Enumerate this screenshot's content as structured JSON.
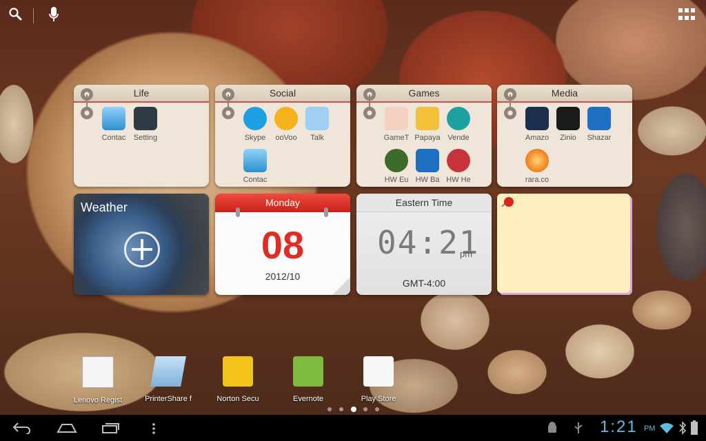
{
  "folders": [
    {
      "title": "Life",
      "apps": [
        {
          "label": "Contac",
          "icon": "contacts-icon"
        },
        {
          "label": "Setting",
          "icon": "settings-icon"
        }
      ]
    },
    {
      "title": "Social",
      "apps": [
        {
          "label": "Skype",
          "icon": "skype-icon"
        },
        {
          "label": "ooVoo",
          "icon": "oovoo-icon"
        },
        {
          "label": "Talk",
          "icon": "talk-icon"
        },
        {
          "label": "Contac",
          "icon": "contacts-icon"
        }
      ]
    },
    {
      "title": "Games",
      "apps": [
        {
          "label": "GameT",
          "icon": "game-icon"
        },
        {
          "label": "Papaya",
          "icon": "papaya-icon"
        },
        {
          "label": "Vende",
          "icon": "vende-icon"
        },
        {
          "label": "HW Eu",
          "icon": "hw-game-icon"
        },
        {
          "label": "HW Ba",
          "icon": "hw-game-icon"
        },
        {
          "label": "HW He",
          "icon": "hw-game-icon"
        }
      ]
    },
    {
      "title": "Media",
      "apps": [
        {
          "label": "Amazo",
          "icon": "kindle-icon"
        },
        {
          "label": "Zinio",
          "icon": "zinio-icon"
        },
        {
          "label": "Shazar",
          "icon": "shazam-icon"
        },
        {
          "label": "rara.co",
          "icon": "rara-icon"
        }
      ]
    }
  ],
  "weather": {
    "title": "Weather"
  },
  "calendar": {
    "weekday": "Monday",
    "day": "08",
    "year_month": "2012/10"
  },
  "clock": {
    "zone": "Eastern Time",
    "time": "04:21",
    "ampm": "pm",
    "gmt": "GMT-4:00"
  },
  "dock": [
    {
      "label": "Lenovo Regist",
      "icon": "lenovo-register-icon"
    },
    {
      "label": "PrinterShare f",
      "icon": "printershare-icon"
    },
    {
      "label": "Norton Secu",
      "icon": "norton-icon"
    },
    {
      "label": "Evernote",
      "icon": "evernote-icon"
    },
    {
      "label": "Play Store",
      "icon": "play-store-icon"
    }
  ],
  "status": {
    "time": "1:21",
    "ampm": "PM"
  },
  "colors": {
    "accent_red": "#e02c22",
    "clock_blue": "#5fbbe0"
  }
}
